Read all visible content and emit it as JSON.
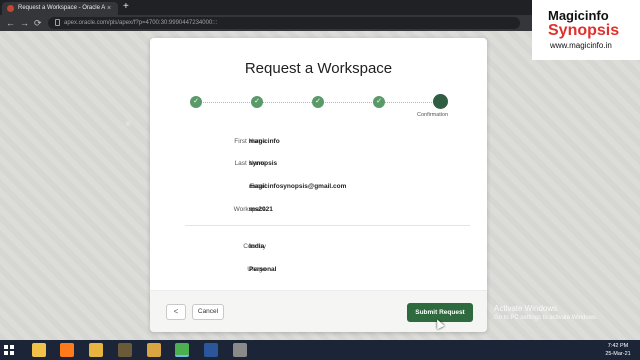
{
  "browser": {
    "tab_title": "Request a Workspace - Oracle A",
    "tab_close": "×",
    "new_tab": "+",
    "url": "apex.oracle.com/pls/apex/f?p=4700:30:9990447234000:::",
    "back": "←",
    "forward": "→",
    "reload": "⟳"
  },
  "card": {
    "title": "Request a Workspace",
    "steps": [
      {
        "state": "done",
        "glyph": "✓"
      },
      {
        "state": "done",
        "glyph": "✓"
      },
      {
        "state": "done",
        "glyph": "✓"
      },
      {
        "state": "done",
        "glyph": "✓"
      },
      {
        "state": "current",
        "glyph": ""
      }
    ],
    "current_step_label": "Confirmation",
    "fields": [
      {
        "label": "First Name",
        "value": "magicinfo"
      },
      {
        "label": "Last Name",
        "value": "synopsis"
      },
      {
        "label": "Email",
        "value": "magicinfosynopsis@gmail.com"
      },
      {
        "label": "Workspace",
        "value": "ms2021"
      },
      {
        "label": "Country",
        "value": "India"
      },
      {
        "label": "Usage",
        "value": "Personal"
      }
    ],
    "prev_button": "<",
    "cancel_button": "Cancel",
    "submit_button": "Submit Request"
  },
  "watermark": {
    "line1": "Magicinfo",
    "line2": "Synopsis",
    "line3": "www.magicinfo.in"
  },
  "activation": {
    "title": "Activate Windows",
    "subtitle": "Go to PC settings to activate Windows."
  },
  "taskbar": {
    "time": "7:42 PM",
    "date": "25-Mar-21",
    "icons": [
      {
        "name": "file-explorer-icon",
        "color": "#f0c24a"
      },
      {
        "name": "firefox-icon",
        "color": "#ff7a1a"
      },
      {
        "name": "folder-icon",
        "color": "#e8b640"
      },
      {
        "name": "media-icon",
        "color": "#6b5a3a"
      },
      {
        "name": "archive-icon",
        "color": "#d9a441"
      },
      {
        "name": "chrome-icon",
        "color": "#4caf50"
      },
      {
        "name": "word-icon",
        "color": "#2b579a"
      },
      {
        "name": "paint-icon",
        "color": "#8a8a8a"
      }
    ]
  }
}
